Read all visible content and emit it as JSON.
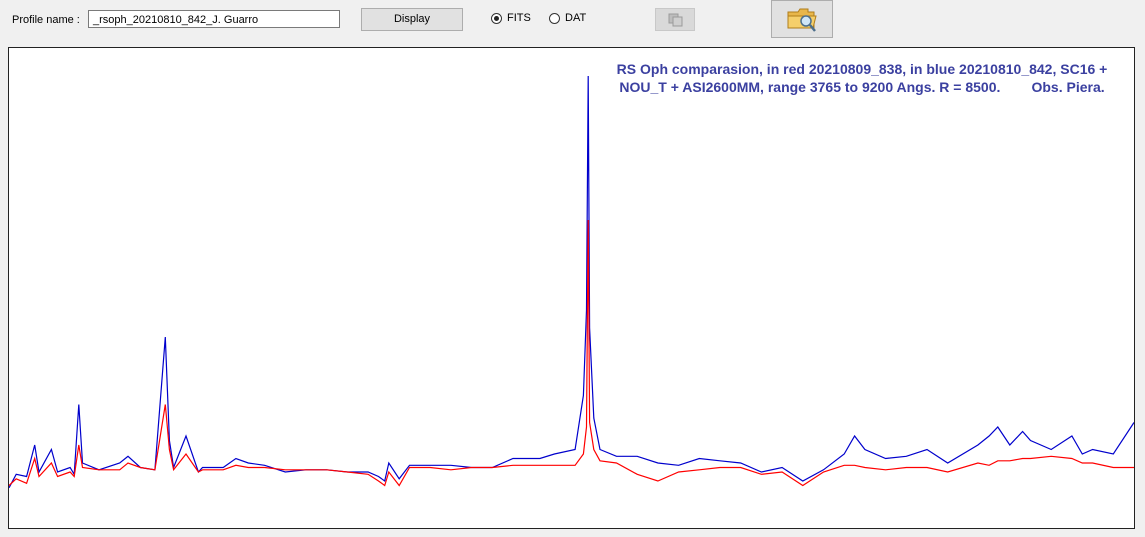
{
  "form": {
    "profile_label": "Profile name :",
    "profile_value": "_rsoph_20210810_842_J. Guarro",
    "display_label": "Display",
    "format_options": [
      {
        "label": "FITS",
        "selected": true
      },
      {
        "label": "DAT",
        "selected": false
      }
    ]
  },
  "icons": {
    "copy": "copy-icon",
    "folder_search": "folder-search-icon"
  },
  "colors": {
    "title": "#3b40a0",
    "red_series": "#ff0000",
    "blue_series": "#0000cc"
  },
  "chart_data": {
    "type": "line",
    "title_line1": "RS Oph comparasion, in red 20210809_838, in blue 20210810_842, SC16 +",
    "title_line2": "NOU_T + ASI2600MM, range 3765 to 9200 Angs. R = 8500.        Obs. Piera.",
    "xlim": [
      3765,
      9200
    ],
    "ylim": [
      0,
      10
    ],
    "grid": false,
    "series": [
      {
        "color": "#0000cc",
        "points": [
          [
            3765,
            0.45
          ],
          [
            3800,
            0.75
          ],
          [
            3850,
            0.7
          ],
          [
            3889,
            1.4
          ],
          [
            3910,
            0.8
          ],
          [
            3970,
            1.3
          ],
          [
            4000,
            0.8
          ],
          [
            4060,
            0.9
          ],
          [
            4080,
            0.75
          ],
          [
            4102,
            2.3
          ],
          [
            4120,
            1.0
          ],
          [
            4200,
            0.85
          ],
          [
            4300,
            1.0
          ],
          [
            4340,
            1.15
          ],
          [
            4400,
            0.9
          ],
          [
            4470,
            0.85
          ],
          [
            4520,
            3.8
          ],
          [
            4540,
            1.5
          ],
          [
            4560,
            0.9
          ],
          [
            4620,
            1.6
          ],
          [
            4680,
            0.8
          ],
          [
            4700,
            0.9
          ],
          [
            4800,
            0.9
          ],
          [
            4861,
            1.1
          ],
          [
            4921,
            1.0
          ],
          [
            5000,
            0.95
          ],
          [
            5100,
            0.8
          ],
          [
            5200,
            0.85
          ],
          [
            5300,
            0.85
          ],
          [
            5400,
            0.8
          ],
          [
            5500,
            0.8
          ],
          [
            5550,
            0.7
          ],
          [
            5580,
            0.6
          ],
          [
            5600,
            1.0
          ],
          [
            5650,
            0.65
          ],
          [
            5700,
            0.95
          ],
          [
            5800,
            0.95
          ],
          [
            5900,
            0.95
          ],
          [
            6000,
            0.9
          ],
          [
            6100,
            0.9
          ],
          [
            6200,
            1.1
          ],
          [
            6330,
            1.1
          ],
          [
            6400,
            1.2
          ],
          [
            6500,
            1.3
          ],
          [
            6540,
            2.5
          ],
          [
            6555,
            4.4
          ],
          [
            6563,
            9.6
          ],
          [
            6570,
            4.0
          ],
          [
            6590,
            2.0
          ],
          [
            6620,
            1.3
          ],
          [
            6700,
            1.15
          ],
          [
            6800,
            1.15
          ],
          [
            6900,
            1.0
          ],
          [
            7000,
            0.95
          ],
          [
            7100,
            1.1
          ],
          [
            7200,
            1.05
          ],
          [
            7300,
            1.0
          ],
          [
            7400,
            0.8
          ],
          [
            7500,
            0.9
          ],
          [
            7600,
            0.6
          ],
          [
            7700,
            0.85
          ],
          [
            7800,
            1.2
          ],
          [
            7850,
            1.6
          ],
          [
            7900,
            1.3
          ],
          [
            8000,
            1.1
          ],
          [
            8100,
            1.15
          ],
          [
            8200,
            1.3
          ],
          [
            8300,
            1.0
          ],
          [
            8446,
            1.4
          ],
          [
            8500,
            1.6
          ],
          [
            8542,
            1.8
          ],
          [
            8600,
            1.4
          ],
          [
            8662,
            1.7
          ],
          [
            8700,
            1.5
          ],
          [
            8800,
            1.3
          ],
          [
            8900,
            1.6
          ],
          [
            8950,
            1.2
          ],
          [
            9000,
            1.3
          ],
          [
            9100,
            1.2
          ],
          [
            9200,
            1.9
          ]
        ]
      },
      {
        "color": "#ff0000",
        "points": [
          [
            3765,
            0.5
          ],
          [
            3800,
            0.65
          ],
          [
            3850,
            0.55
          ],
          [
            3889,
            1.1
          ],
          [
            3910,
            0.7
          ],
          [
            3970,
            1.0
          ],
          [
            4000,
            0.7
          ],
          [
            4060,
            0.8
          ],
          [
            4080,
            0.7
          ],
          [
            4102,
            1.4
          ],
          [
            4120,
            0.9
          ],
          [
            4200,
            0.85
          ],
          [
            4300,
            0.85
          ],
          [
            4340,
            1.0
          ],
          [
            4400,
            0.9
          ],
          [
            4470,
            0.85
          ],
          [
            4520,
            2.3
          ],
          [
            4540,
            1.3
          ],
          [
            4560,
            0.85
          ],
          [
            4620,
            1.2
          ],
          [
            4680,
            0.8
          ],
          [
            4700,
            0.85
          ],
          [
            4800,
            0.85
          ],
          [
            4861,
            0.95
          ],
          [
            4921,
            0.9
          ],
          [
            5000,
            0.9
          ],
          [
            5100,
            0.85
          ],
          [
            5200,
            0.85
          ],
          [
            5300,
            0.85
          ],
          [
            5400,
            0.8
          ],
          [
            5500,
            0.75
          ],
          [
            5550,
            0.6
          ],
          [
            5580,
            0.5
          ],
          [
            5600,
            0.8
          ],
          [
            5650,
            0.5
          ],
          [
            5700,
            0.9
          ],
          [
            5800,
            0.9
          ],
          [
            5900,
            0.85
          ],
          [
            6000,
            0.9
          ],
          [
            6100,
            0.9
          ],
          [
            6200,
            0.95
          ],
          [
            6330,
            0.95
          ],
          [
            6400,
            0.95
          ],
          [
            6500,
            0.95
          ],
          [
            6540,
            1.2
          ],
          [
            6555,
            1.8
          ],
          [
            6563,
            6.4
          ],
          [
            6570,
            1.9
          ],
          [
            6590,
            1.3
          ],
          [
            6620,
            1.05
          ],
          [
            6700,
            1.0
          ],
          [
            6800,
            0.75
          ],
          [
            6900,
            0.6
          ],
          [
            7000,
            0.8
          ],
          [
            7100,
            0.85
          ],
          [
            7200,
            0.9
          ],
          [
            7300,
            0.9
          ],
          [
            7400,
            0.75
          ],
          [
            7500,
            0.8
          ],
          [
            7600,
            0.5
          ],
          [
            7700,
            0.8
          ],
          [
            7800,
            0.95
          ],
          [
            7850,
            0.95
          ],
          [
            7900,
            0.9
          ],
          [
            8000,
            0.85
          ],
          [
            8100,
            0.9
          ],
          [
            8200,
            0.9
          ],
          [
            8300,
            0.8
          ],
          [
            8446,
            1.0
          ],
          [
            8500,
            0.95
          ],
          [
            8542,
            1.05
          ],
          [
            8600,
            1.05
          ],
          [
            8662,
            1.1
          ],
          [
            8700,
            1.1
          ],
          [
            8800,
            1.15
          ],
          [
            8900,
            1.1
          ],
          [
            8950,
            1.0
          ],
          [
            9000,
            1.0
          ],
          [
            9100,
            0.9
          ],
          [
            9200,
            0.9
          ]
        ]
      }
    ]
  }
}
